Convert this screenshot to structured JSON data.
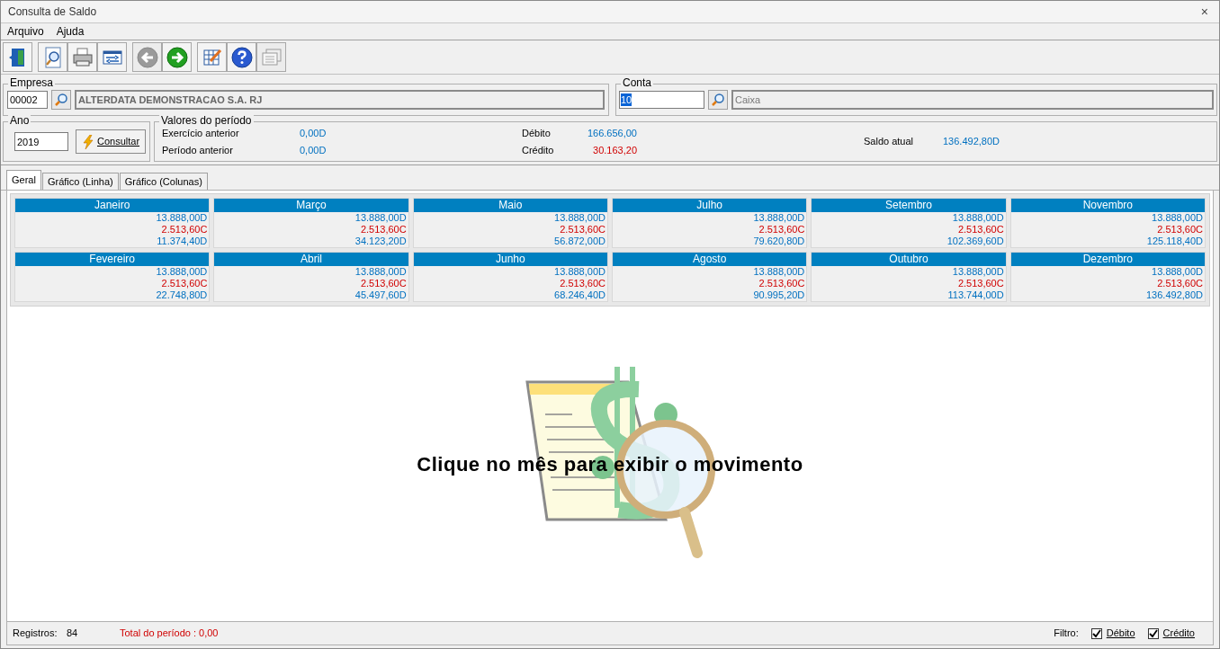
{
  "window": {
    "title": "Consulta de Saldo",
    "close": "×"
  },
  "menu": [
    "Arquivo",
    "Ajuda"
  ],
  "toolbar": [
    [
      {
        "kind": "exit",
        "disabled": false
      }
    ],
    [
      {
        "kind": "preview",
        "disabled": false
      },
      {
        "kind": "print",
        "disabled": false
      },
      {
        "kind": "export",
        "disabled": false
      }
    ],
    [
      {
        "kind": "back",
        "disabled": true
      },
      {
        "kind": "forward",
        "disabled": false
      }
    ],
    [
      {
        "kind": "edit",
        "disabled": false
      },
      {
        "kind": "help",
        "disabled": false
      },
      {
        "kind": "windows",
        "disabled": true
      }
    ]
  ],
  "empresa": {
    "legend": "Empresa",
    "code": "00002",
    "name": "ALTERDATA DEMONSTRACAO S.A. RJ"
  },
  "conta": {
    "legend": "Conta",
    "code": "10",
    "name": "Caixa"
  },
  "ano": {
    "legend": "Ano",
    "value": "2019",
    "button": "Consultar"
  },
  "valores": {
    "legend": "Valores do período",
    "left": [
      {
        "label": "Exercício anterior",
        "value": "0,00D",
        "kind": "debit"
      },
      {
        "label": "Período anterior",
        "value": "0,00D",
        "kind": "debit"
      }
    ],
    "middle": [
      {
        "label": "Débito",
        "value": "166.656,00",
        "kind": "debit"
      },
      {
        "label": "Crédito",
        "value": "30.163,20",
        "kind": "credit"
      }
    ],
    "saldo": {
      "label": "Saldo atual",
      "value": "136.492,80D"
    }
  },
  "tabs": [
    {
      "label": "Geral",
      "selected": true
    },
    {
      "label": "Gráfico (Linha)",
      "selected": false
    },
    {
      "label": "Gráfico (Colunas)",
      "selected": false
    }
  ],
  "months": [
    {
      "name": "Janeiro",
      "debit": "13.888,00D",
      "credit": "2.513,60C",
      "balance": "11.374,40D"
    },
    {
      "name": "Março",
      "debit": "13.888,00D",
      "credit": "2.513,60C",
      "balance": "34.123,20D"
    },
    {
      "name": "Maio",
      "debit": "13.888,00D",
      "credit": "2.513,60C",
      "balance": "56.872,00D"
    },
    {
      "name": "Julho",
      "debit": "13.888,00D",
      "credit": "2.513,60C",
      "balance": "79.620,80D"
    },
    {
      "name": "Setembro",
      "debit": "13.888,00D",
      "credit": "2.513,60C",
      "balance": "102.369,60D"
    },
    {
      "name": "Novembro",
      "debit": "13.888,00D",
      "credit": "2.513,60C",
      "balance": "125.118,40D"
    },
    {
      "name": "Fevereiro",
      "debit": "13.888,00D",
      "credit": "2.513,60C",
      "balance": "22.748,80D"
    },
    {
      "name": "Abril",
      "debit": "13.888,00D",
      "credit": "2.513,60C",
      "balance": "45.497,60D"
    },
    {
      "name": "Junho",
      "debit": "13.888,00D",
      "credit": "2.513,60C",
      "balance": "68.246,40D"
    },
    {
      "name": "Agosto",
      "debit": "13.888,00D",
      "credit": "2.513,60C",
      "balance": "90.995,20D"
    },
    {
      "name": "Outubro",
      "debit": "13.888,00D",
      "credit": "2.513,60C",
      "balance": "113.744,00D"
    },
    {
      "name": "Dezembro",
      "debit": "13.888,00D",
      "credit": "2.513,60C",
      "balance": "136.492,80D"
    }
  ],
  "hint": "Clique no mês para exibir o movimento",
  "status_bar": {
    "registros_label": "Registros:",
    "registros": "84",
    "total": "Total do período : 0,00",
    "filtro": "Filtro:",
    "filters": [
      {
        "label": "Débito",
        "checked": true
      },
      {
        "label": "Crédito",
        "checked": true
      }
    ]
  }
}
